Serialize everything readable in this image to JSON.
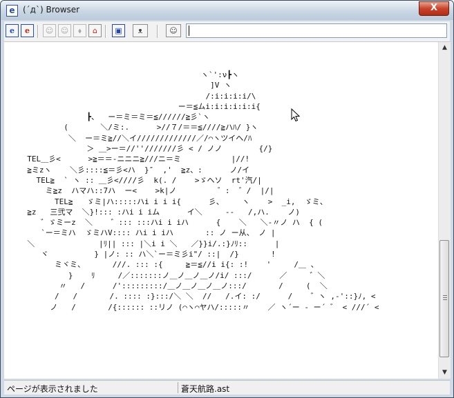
{
  "window": {
    "title": "(´д`) Browser"
  },
  "titlebar": {
    "app_icon": "e",
    "close_label": "X"
  },
  "toolbar": {
    "buttons": [
      {
        "name": "ie-icon",
        "glyph": "e"
      },
      {
        "name": "ie-red-icon",
        "glyph": "e"
      },
      {
        "name": "back-icon",
        "glyph": "☺"
      },
      {
        "name": "forward-icon",
        "glyph": "☺"
      },
      {
        "name": "stop-icon",
        "glyph": "⬧"
      },
      {
        "name": "home-icon",
        "glyph": "⌂"
      },
      {
        "name": "favorites-icon",
        "glyph": "▣"
      },
      {
        "name": "mona-face-icon",
        "glyph": "ᴥ"
      },
      {
        "name": "search-face-icon",
        "glyph": "☺"
      }
    ],
    "address_value": ""
  },
  "content": {
    "ascii_art": "                                        ヽ`':ν┣ヽ\n                                          ]V ヽ\n                                         /:i:i:i:i/\\\n                                   ー＝≦ムi:i:i:i:i:i{\n               ┣、  ー＝ミ＝ミ＝≦//////≧彡`ヽ\n          (       ＼/ミ:.      >//７/＝＝≦////≧ハﾊ/ }ヽ\n           ＼  ー＝ミ≧//＼イ/////////////／/⌒ヽツイヘ/ﾊ\n               ＞ ＿>ー＝//''///////彡 < / ノノ        {/}\n  TEL＿彡<      >≧＝＝-ニニニ≧///ニ＝ミ           |//!\n  ≧ミzヽ    ＼彡::::≦＝彡<ハ  }″  ,'  ≧z、:      ノ/イ\n    TEL≧  ` ヽ :: ＿彡<////彡  k(. /    >ゞヘソ  rt'汽/|\n      ミ≧z  ハマハ::7ハ  ー<    >k|ノ         ゛:  ゛/  |/|\n        TEL≧   ゞミ|ハ:::::ハi i i i{      彡、    ヽ    >  _i,  ゞミ、\n  ≧z   三弐マ  ＼}!::: :ハi i iム      イ＼     --   /,ハ.    ノ)\n     ゛ゞミーz  ＼    ゛::: :::ハi i iハ      {    ＼   ＼-〃ノ ハ  { (\n     `ー＝ミハ  ゞミハV:::: ハi i iハ       :: ノ ー从、 ノ |\n  ＼              |ﾘ|| ::: |＼i i ＼   ／}}i/.:}ﾉﾘ::      |\n     ヾ          } |ノ: :: ハ＼`ー＝ミ彡i\"/ ::|  /}       !\n        ミヾミ、      ///. ::: :{     ≧＝≦//i i{: :!    '     /＿ 、\n           }    ﾘ     /／:::::::ノ＿ノ＿ノ＿ノ/i/ :::/      ／     ゛＼\n         〃   /      /':::::::::/＿ノ＿ノ＿ノ＿ノ:::/       /     (  ＼\n        /   /       /. :::: :}:::/＼ ＼  //   /.イ: :/      /    ゛ヽ ,-'::}ﾉ, <\n       ノ   /       /{:::::: ::リノ (⌒ヽ⌒ヤハ/:::::〃    ／ ヽ´ー ‐ ー´ ゛ < ///´ <"
  },
  "status": {
    "message": "ページが表示されました",
    "filename": "蒼天航路.ast"
  },
  "colors": {
    "title_gradient_top": "#eef3f8",
    "close_button": "#c8432b",
    "ie_blue": "#1f4fb5"
  }
}
